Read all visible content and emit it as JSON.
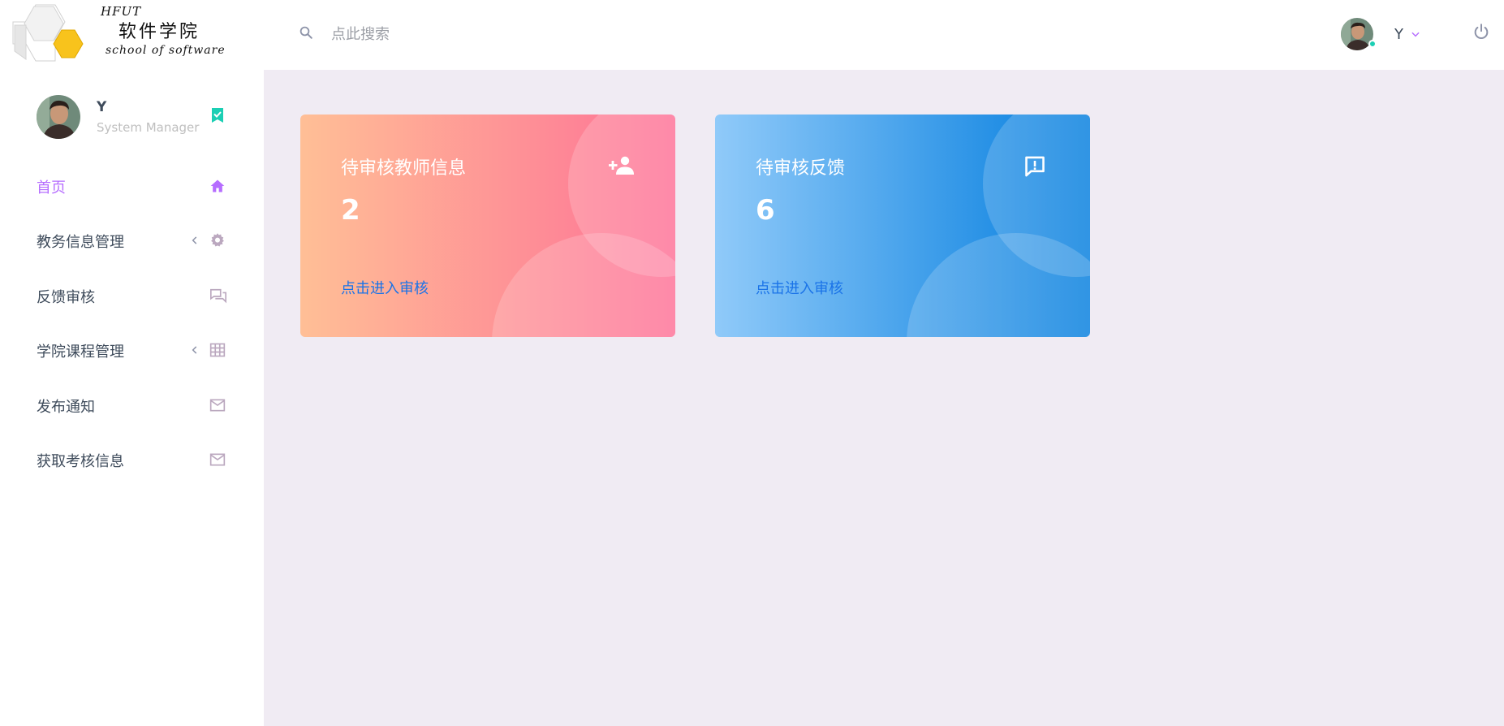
{
  "brand": {
    "hfut": "HFUT",
    "name_cn": "软件学院",
    "name_en": "school of software",
    "hex_colors": {
      "grey": "#e9e9e9",
      "yellow": "#f8c31c"
    }
  },
  "search": {
    "icon": "search-icon",
    "placeholder": "点此搜索",
    "value": ""
  },
  "header": {
    "user_name": "Y",
    "online_color": "#1bcfb4",
    "caret_icon": "chevron-down-icon",
    "power_icon": "power-icon"
  },
  "sidebar": {
    "profile": {
      "name": "Y",
      "role": "System Manager",
      "badge_icon": "bookmark-check-icon"
    },
    "items": [
      {
        "label": "首页",
        "icon": "home-icon",
        "active": true,
        "has_arrow": false
      },
      {
        "label": "教务信息管理",
        "icon": "gear-icon",
        "active": false,
        "has_arrow": true
      },
      {
        "label": "反馈审核",
        "icon": "forum-icon",
        "active": false,
        "has_arrow": false
      },
      {
        "label": "学院课程管理",
        "icon": "table-icon",
        "active": false,
        "has_arrow": true
      },
      {
        "label": "发布通知",
        "icon": "email-icon",
        "active": false,
        "has_arrow": false
      },
      {
        "label": "获取考核信息",
        "icon": "email-icon",
        "active": false,
        "has_arrow": false
      }
    ]
  },
  "cards": [
    {
      "title": "待审核教师信息",
      "value": "2",
      "link": "点击进入审核",
      "icon": "account-plus-icon",
      "gradient": [
        "#ffbf96",
        "#fe7096"
      ]
    },
    {
      "title": "待审核反馈",
      "value": "6",
      "link": "点击进入审核",
      "icon": "message-alert-icon",
      "gradient": [
        "#90caf9",
        "#047edf"
      ]
    }
  ],
  "colors": {
    "accent": "#b66dff",
    "background": "#f0ebf3",
    "link": "#1a73e8"
  }
}
